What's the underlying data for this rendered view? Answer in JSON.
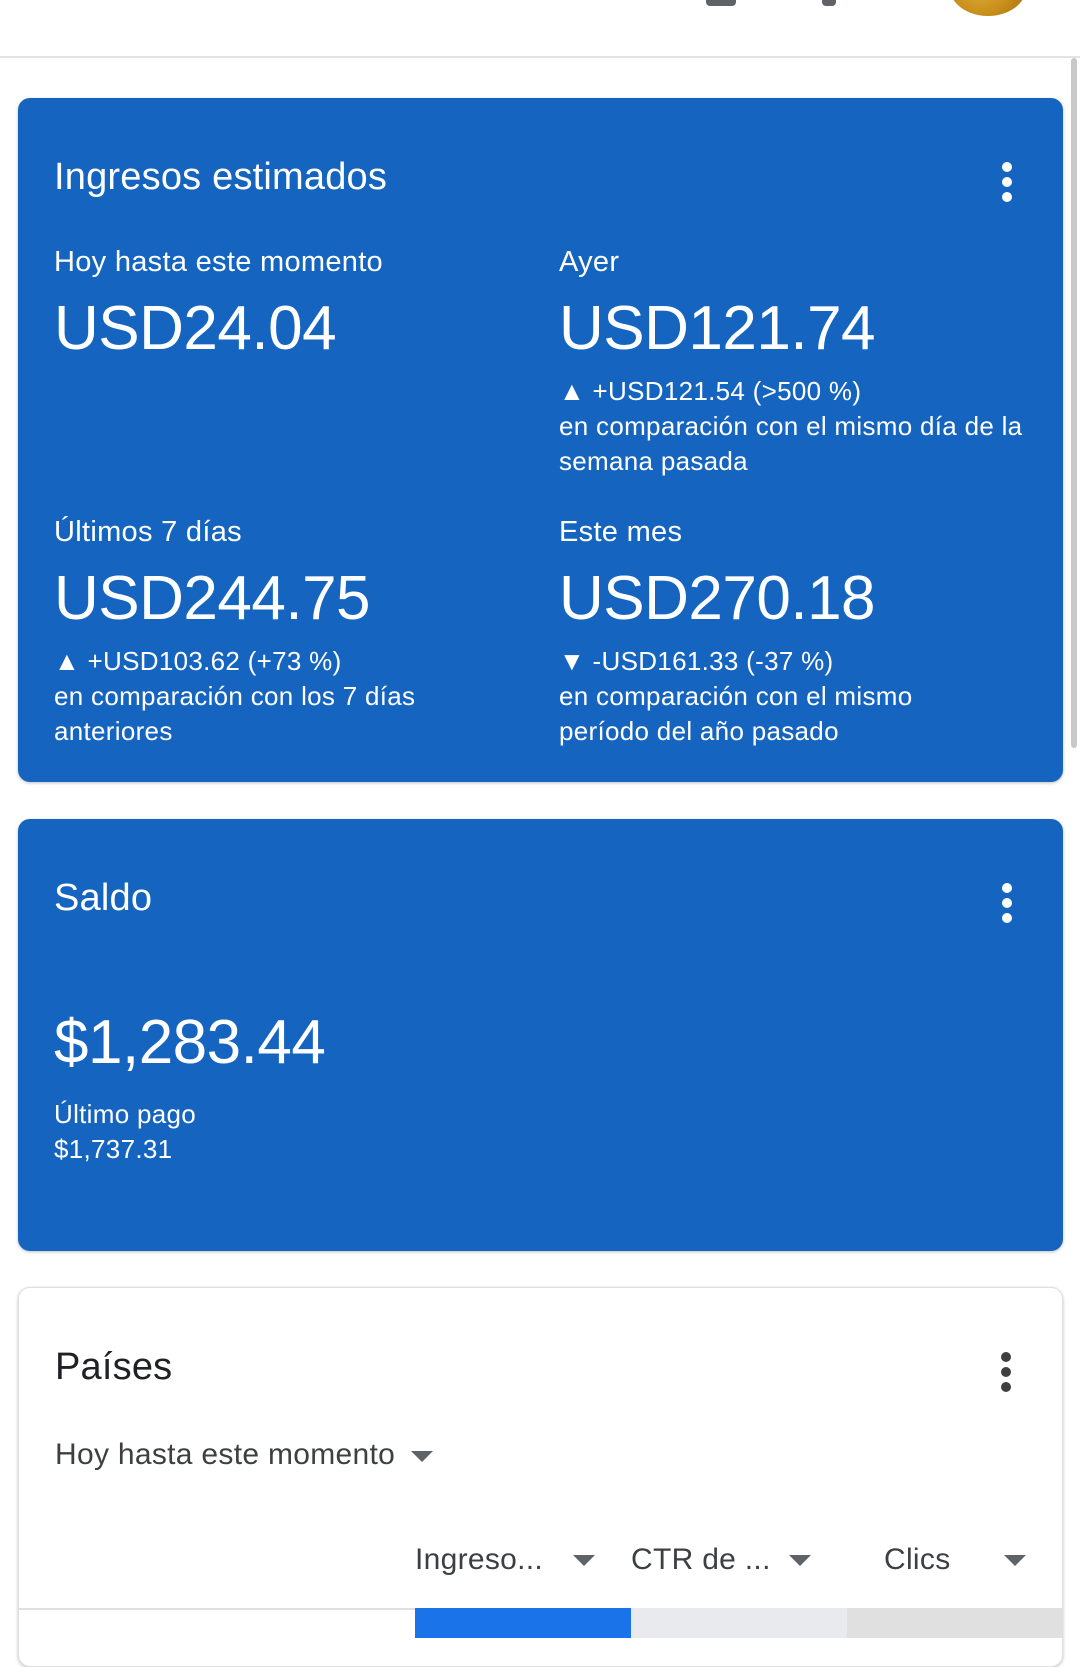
{
  "colors": {
    "card_blue": "#1565c0",
    "text_on_blue": "#ffffff",
    "selected_column": "#1a73e8",
    "unselected_column": "#e8eaed"
  },
  "header": {
    "avatar_icon": "user-avatar"
  },
  "earnings": {
    "title": "Ingresos estimados",
    "menu_icon": "more-vert-icon",
    "today": {
      "label": "Hoy hasta este momento",
      "value": "USD24.04"
    },
    "yesterday": {
      "label": "Ayer",
      "value": "USD121.74",
      "delta": "▲ +USD121.54 (>500 %)",
      "comparison": "en comparación con el mismo día de la semana pasada"
    },
    "last7": {
      "label": "Últimos 7 días",
      "value": "USD244.75",
      "delta": "▲ +USD103.62 (+73 %)",
      "comparison": "en comparación con los 7 días anteriores"
    },
    "month": {
      "label": "Este mes",
      "value": "USD270.18",
      "delta": "▼ -USD161.33 (-37 %)",
      "comparison": "en comparación con el mismo período del año pasado"
    }
  },
  "balance": {
    "title": "Saldo",
    "menu_icon": "more-vert-icon",
    "value": "$1,283.44",
    "last_payment_label": "Último pago",
    "last_payment_value": "$1,737.31"
  },
  "countries": {
    "title": "Países",
    "menu_icon": "more-vert-icon",
    "period": "Hoy hasta este momento",
    "columns": [
      {
        "label": "Ingreso...",
        "selected": true
      },
      {
        "label": "CTR de ...",
        "selected": false
      },
      {
        "label": "Clics",
        "selected": false
      }
    ]
  }
}
